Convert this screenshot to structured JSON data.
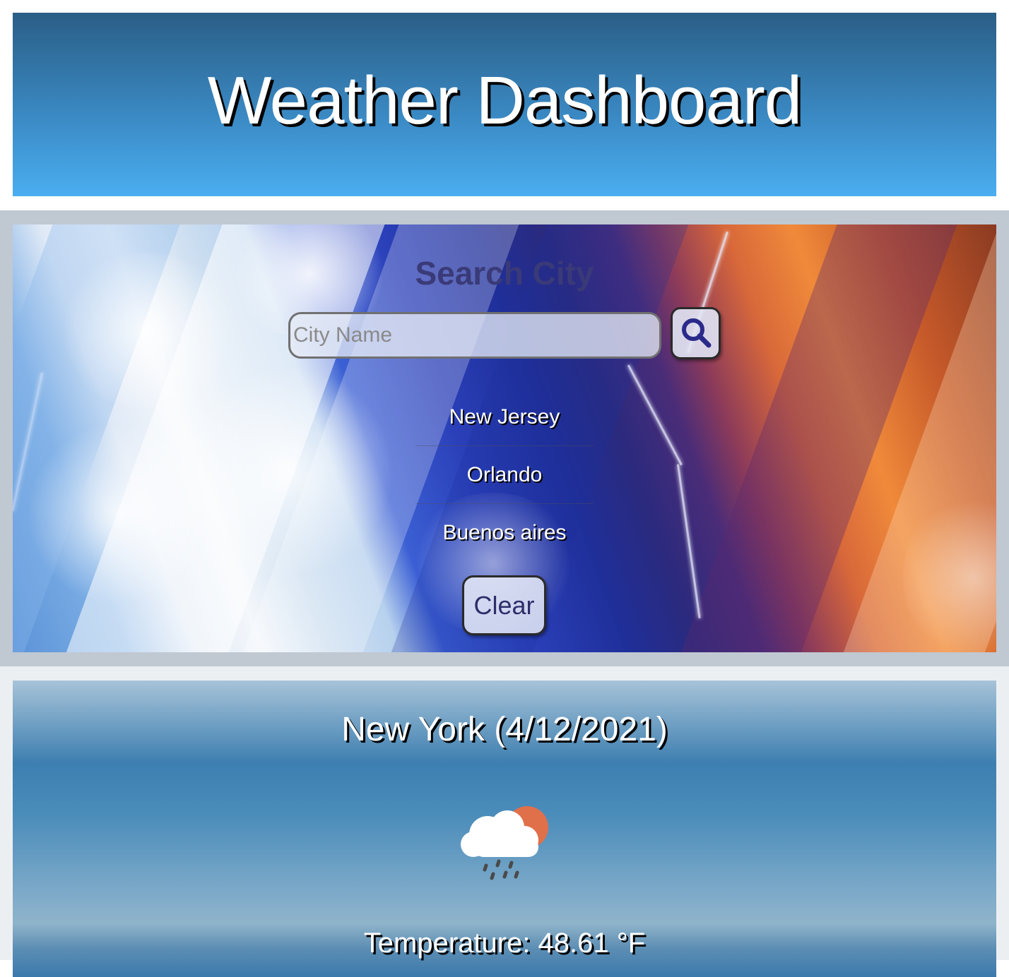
{
  "header": {
    "title": "Weather Dashboard"
  },
  "search": {
    "title": "Search City",
    "placeholder": "City Name",
    "search_icon": "search-icon",
    "history": [
      {
        "label": "New Jersey"
      },
      {
        "label": "Orlando"
      },
      {
        "label": "Buenos aires"
      }
    ],
    "clear_label": "Clear"
  },
  "current": {
    "title": "New York (4/12/2021)",
    "icon": "rain-cloud-sun-icon",
    "temperature": "Temperature: 48.61 °F"
  },
  "colors": {
    "header_top": "#2a5e86",
    "header_bottom": "#4aaef0",
    "search_title": "#3a3a78",
    "sun": "#e0704a"
  }
}
